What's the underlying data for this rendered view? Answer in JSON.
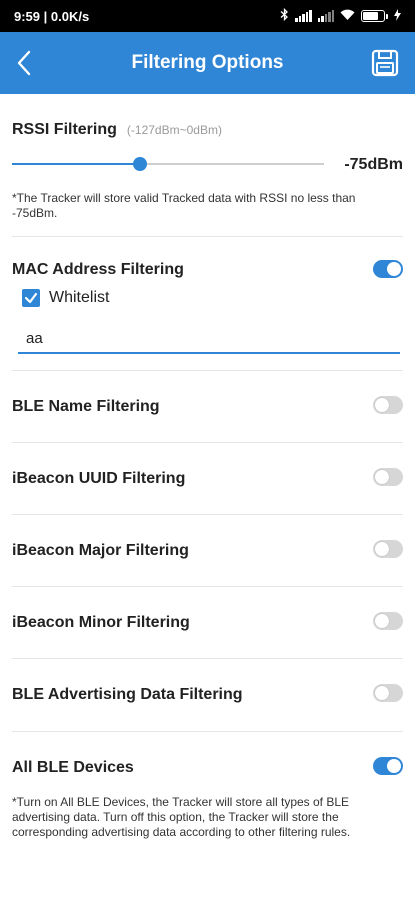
{
  "status_bar": {
    "time_speed": "9:59 | 0.0K/s",
    "battery_level": 0.8,
    "icons": [
      "bluetooth-icon",
      "signal-icon",
      "signal-icon",
      "wifi-icon",
      "battery-icon",
      "charging-icon"
    ]
  },
  "app_bar": {
    "title": "Filtering Options",
    "back_icon": "chevron-left-icon",
    "save_icon": "save-icon",
    "color": "#2f86d6"
  },
  "rssi": {
    "label": "RSSI Filtering",
    "range_hint": "(-127dBm~0dBm)",
    "value_label": "-75dBm",
    "level": 0.41,
    "note": "*The Tracker will store valid Tracked data with RSSI no less than -75dBm."
  },
  "mac": {
    "label": "MAC Address Filtering",
    "enabled": true,
    "whitelist_label": "Whitelist",
    "whitelist_checked": true,
    "input_value": "aa"
  },
  "filters": [
    {
      "label": "BLE Name Filtering",
      "enabled": false
    },
    {
      "label": "iBeacon UUID Filtering",
      "enabled": false
    },
    {
      "label": "iBeacon Major Filtering",
      "enabled": false
    },
    {
      "label": "iBeacon Minor Filtering",
      "enabled": false
    },
    {
      "label": "BLE Advertising Data Filtering",
      "enabled": false
    }
  ],
  "all_ble": {
    "label": "All BLE Devices",
    "enabled": true,
    "note": "*Turn on All BLE Devices, the Tracker will store all types of BLE advertising data. Turn off this option, the Tracker will store the corresponding advertising data according to other filtering rules."
  }
}
